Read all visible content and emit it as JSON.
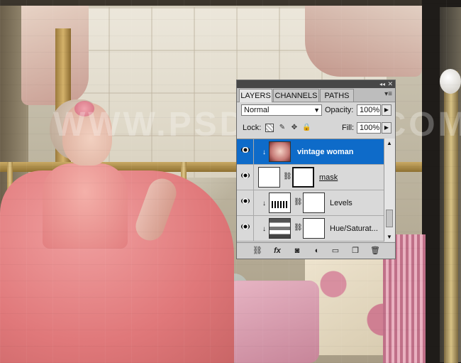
{
  "watermark": "WWW.PSD-DUDE.COM",
  "panel": {
    "tabs": [
      {
        "label": "LAYERS",
        "active": true
      },
      {
        "label": "CHANNELS",
        "active": false
      },
      {
        "label": "PATHS",
        "active": false
      }
    ],
    "blend_mode": "Normal",
    "opacity_label": "Opacity:",
    "opacity_value": "100%",
    "lock_label": "Lock:",
    "fill_label": "Fill:",
    "fill_value": "100%",
    "layers": [
      {
        "name": "vintage woman",
        "selected": true,
        "type": "photo"
      },
      {
        "name": "mask",
        "selected": false,
        "type": "mask"
      },
      {
        "name": "Levels",
        "selected": false,
        "type": "levels"
      },
      {
        "name": "Hue/Saturat...",
        "selected": false,
        "type": "huesat"
      }
    ],
    "bottom_icons": [
      "link-icon",
      "fx-icon",
      "add-mask-icon",
      "adjustment-icon",
      "group-folder-icon",
      "new-layer-icon",
      "trash-icon"
    ]
  },
  "colors": {
    "selected_layer": "#0e6bc9",
    "panel_bg": "#d6d6d6"
  }
}
